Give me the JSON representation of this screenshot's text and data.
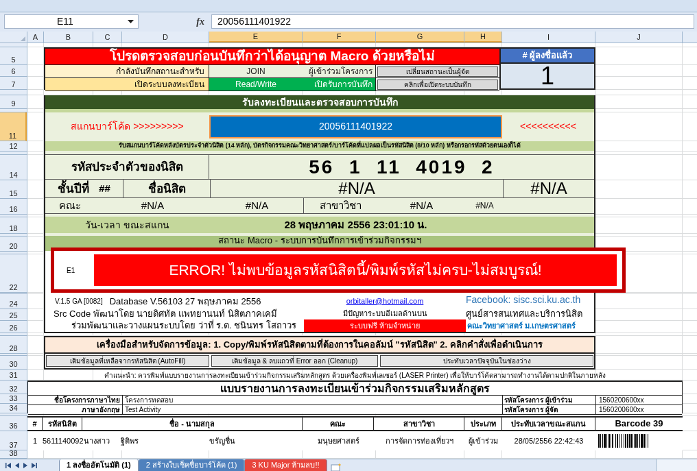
{
  "formula_bar": {
    "name_box": "E11",
    "fx": "fx",
    "value": "20056111401922"
  },
  "columns": [
    {
      "label": "A",
      "selected": false
    },
    {
      "label": "B",
      "selected": false
    },
    {
      "label": "C",
      "selected": false
    },
    {
      "label": "D",
      "selected": false
    },
    {
      "label": "E",
      "selected": true
    },
    {
      "label": "F",
      "selected": true
    },
    {
      "label": "G",
      "selected": true
    },
    {
      "label": "H",
      "selected": true
    },
    {
      "label": "I",
      "selected": false
    },
    {
      "label": "J",
      "selected": false
    }
  ],
  "rows": [
    {
      "label": "5",
      "selected": false
    },
    {
      "label": "6",
      "selected": false
    },
    {
      "label": "7",
      "selected": false
    },
    {
      "label": "9",
      "selected": false
    },
    {
      "label": "11",
      "selected": true
    },
    {
      "label": "12",
      "selected": false
    },
    {
      "label": "14",
      "selected": false
    },
    {
      "label": "15",
      "selected": false
    },
    {
      "label": "16",
      "selected": false
    },
    {
      "label": "18",
      "selected": false
    },
    {
      "label": "20",
      "selected": false
    },
    {
      "label": "22",
      "selected": false
    },
    {
      "label": "24",
      "selected": false
    },
    {
      "label": "25",
      "selected": false
    },
    {
      "label": "26",
      "selected": false
    },
    {
      "label": "28",
      "selected": false
    },
    {
      "label": "30",
      "selected": false
    },
    {
      "label": "31",
      "selected": false
    },
    {
      "label": "32",
      "selected": false
    },
    {
      "label": "33",
      "selected": false
    },
    {
      "label": "34",
      "selected": false
    },
    {
      "label": "36",
      "selected": false
    },
    {
      "label": "37",
      "selected": false
    },
    {
      "label": "38",
      "selected": false
    }
  ],
  "header": {
    "title": "โปรดตรวจสอบก่อนบันทึกว่าได้อนุญาต Macro ด้วยหรือไม่",
    "count_label": "# ผู้ลงชื่อแล้ว",
    "count": "1",
    "status_rows": [
      {
        "label": "กำลังบันทึกสถานะสำหรับ",
        "value": "JOIN",
        "detail": "ผู้เข้าร่วมโครงการ",
        "button": "เปลี่ยนสถานะเป็นผู้จัด",
        "on": false
      },
      {
        "label": "เปิดระบบลงทะเบียน",
        "value": "Read/Write",
        "detail": "เปิดรับการบันทึก",
        "button": "คลิกเพื่อเปิดระบบบันทึก",
        "on": true
      }
    ]
  },
  "scan": {
    "title": "รับลงทะเบียนและตรวจสอบการบันทึก",
    "barcode_label": "สแกนบาร์โค้ด >>>>>>>>>",
    "barcode_value": "20056111401922",
    "arrows": "<<<<<<<<<<",
    "hint": "รับสแกนบาร์โค้ดหลังบัตรประจำตัวนิสิต (14 หลัก), บัตรกิจกรรมคณะวิทยาศาสตร์/บาร์โค้ดที่แปลผลเป็นรหัสนิสิต (8/10 หลัก) หรือกรอกรหัสด้วยตนเองก็ได้",
    "student_id_label": "รหัสประจำตัวของนิสิต",
    "student_id": "56  1  11  4019  2",
    "year_label": "ชั้นปีที่",
    "year": "##",
    "name_label": "ชื่อนิสิต",
    "name": "#N/A",
    "name_extra": "#N/A",
    "faculty_label": "คณะ",
    "faculty": "#N/A",
    "faculty_extra": "#N/A",
    "major_label": "สาขาวิชา",
    "major": "#N/A",
    "major_extra": "#N/A",
    "time_label": "วัน-เวลา ขณะสแกน",
    "time": "28 พฤษภาคม 2556 23:01:10 น.",
    "macro_status": "สถานะ Macro - ระบบการบันทึกการเข้าร่วมกิจกรรมฯ"
  },
  "error": {
    "code": "E1",
    "message": "ERROR! ไม่พบข้อมูลรหัสนิสิตนี้/พิมพ์รหัสไม่ครบ-ไม่สมบูรณ์!"
  },
  "credits": {
    "version": "V.1.5 GA [0082]",
    "database": "Database V.56103  27 พฤษภาคม 2556",
    "developer": "Src Code พัฒนาโดย นายดิศทัต  แพทยานนท์ นิสิตภาคเคมี",
    "planner": "ร่วมพัฒนาและวางแผนระบบโดย ว่าที่ ร.ต. ชนินทร โสถาวร",
    "email": "orbitaller@hotmail.com",
    "email_note": "มีปัญหาระบบอีเมลด้านบน",
    "notice": "ระบบฟรี ห้ามจำหน่าย",
    "facebook": "Facebook: sisc.sci.ku.ac.th",
    "center": "ศูนย์สารสนเทศและบริการนิสิต",
    "faculty": "คณะวิทยาศาสตร์ ม.เกษตรศาสตร์"
  },
  "tools": {
    "title": "เครื่องมือสำหรับจัดการข้อมูล: 1. Copy/พิมพ์รหัสนิสิตตามที่ต้องการในคอลัมน์ \"รหัสนิสิต\" 2. คลิกคำสั่งเพื่อดำเนินการ",
    "buttons": [
      "เติมข้อมูลที่เหลือจากรหัสนิสิต (AutoFill)",
      "เติมข้อมูล & ลบแถวที่ Error ออก (Cleanup)",
      "ประทับเวลาปัจจุบันในช่องว่าง"
    ]
  },
  "advice": "คำแนะนำ: ควรพิมพ์แบบรายงานการลงทะเบียนเข้าร่วมกิจกรรมเสริมหลักสูตร ด้วยเครื่องพิมพ์เลเซอร์ (LASER Printer) เพื่อให้บาร์โค้ดสามารถทำงานได้ตามปกติในภายหลัง",
  "report": {
    "title": "แบบรายงานการลงทะเบียนเข้าร่วมกิจกรรมเสริมหลักสูตร",
    "fields": [
      {
        "label": "ชื่อโครงการภาษาไทย",
        "value": "โครงการทดสอบ",
        "code_label": "รหัสโครงการ ผู้เข้าร่วม",
        "code": "1560200600xx"
      },
      {
        "label": "ภาษาอังกฤษ",
        "value": "Test Activity",
        "code_label": "รหัสโครงการ ผู้จัด",
        "code": "1560200600xx"
      }
    ],
    "columns": [
      "#",
      "รหัสนิสิต",
      "ชื่อ - นามสกุล",
      "คณะ",
      "สาขาวิชา",
      "ประเภท",
      "ประทับเวลาขณะสแกน",
      "Barcode 39"
    ],
    "rows": [
      {
        "number": "1",
        "student_id": "5611140092",
        "title": "นางสาว",
        "first_name": "ฐิติพร",
        "last_name": "ขรัญชื่น",
        "faculty": "มนุษยศาสตร์",
        "major": "การจัดการท่องเที่ยวฯ",
        "type": "ผู้เข้าร่วม",
        "timestamp": "28/05/2556 22:42:43",
        "has_barcode": true
      }
    ]
  },
  "sheet_tabs": [
    {
      "label": "1 ลงชื่ออัตโนมัติ (1)",
      "selected": true
    },
    {
      "label": "2 สร้างใบเช็คชื่อบาร์โค้ด (1)",
      "selected": false,
      "color": "#4f81bd"
    },
    {
      "label": "3 KU Major ห้ามลบ!!",
      "selected": false,
      "color": "#e8453c"
    }
  ]
}
